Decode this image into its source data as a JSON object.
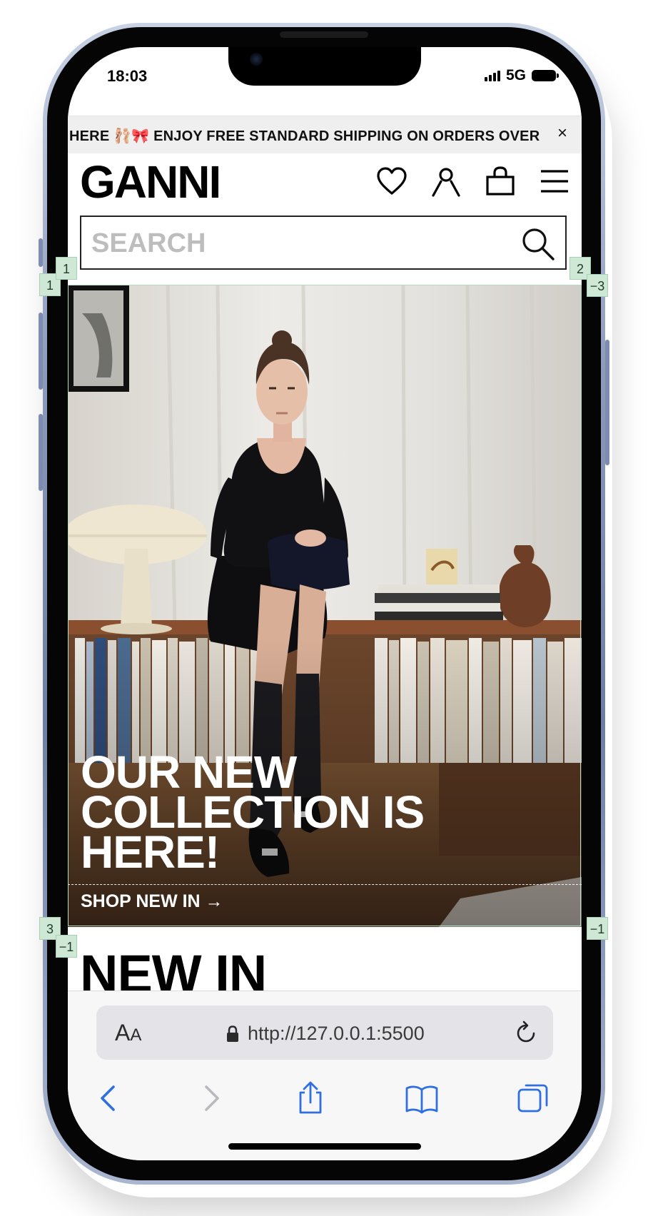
{
  "status_bar": {
    "time": "18:03",
    "network": "5G"
  },
  "announcement": {
    "text": "HERE 🩰🎀 ENJOY FREE STANDARD SHIPPING ON ORDERS OVER",
    "close_symbol": "×"
  },
  "header": {
    "logo": "GANNI",
    "icons": [
      "heart-icon",
      "user-icon",
      "bag-icon",
      "menu-icon"
    ]
  },
  "search": {
    "placeholder": "SEARCH",
    "value": ""
  },
  "hero": {
    "headline": "OUR NEW COLLECTION IS HERE!",
    "cta": "SHOP NEW IN →"
  },
  "guides": {
    "top_left": [
      "1",
      "1"
    ],
    "top_right": [
      "2",
      "−3"
    ],
    "bottom_left": [
      "3",
      "−1"
    ],
    "bottom_right": [
      "−1"
    ]
  },
  "section": {
    "title": "NEW IN"
  },
  "browser": {
    "aa_big": "A",
    "aa_small": "A",
    "url": "http://127.0.0.1:5500",
    "toolbar_icons": [
      "back-icon",
      "forward-icon",
      "share-icon",
      "bookmarks-icon",
      "tabs-icon"
    ]
  },
  "colors": {
    "safari_blue": "#2f6fe0",
    "guide_green": "#cfe8d6",
    "frame_blue": "#7d8cb0"
  }
}
